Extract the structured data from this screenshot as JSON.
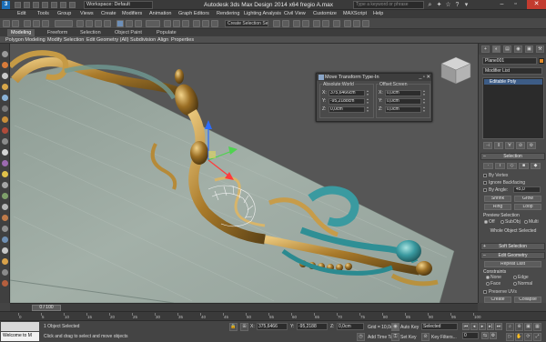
{
  "titlebar": {
    "app_icon_letter": "3",
    "workspace": "Workspace: Default",
    "title": "Autodesk 3ds Max Design 2014 x64     fregio A.max",
    "search_placeholder": "Type a keyword or phrase",
    "minimize": "–",
    "restore": "▫",
    "close": "✕"
  },
  "menu": [
    "Edit",
    "Tools",
    "Group",
    "Views",
    "Create",
    "Modifiers",
    "Animation",
    "Graph Editors",
    "Rendering",
    "Lighting Analysis",
    "Civil View",
    "Customize",
    "MAXScript",
    "Help"
  ],
  "toolbar": {
    "selection_set": "Create Selection Se"
  },
  "ribbon": {
    "tabs": [
      "Modeling",
      "Freeform",
      "Selection",
      "Object Paint",
      "Populate"
    ],
    "active_tab": 0,
    "sub": [
      "Polygon Modeling",
      "Modify Selection",
      "Edit",
      "Geometry (All)",
      "Subdivision",
      "Align",
      "Properties"
    ]
  },
  "viewport": {
    "label": "[+] [Perspective] [Shaded + Edged Faces]"
  },
  "move_dialog": {
    "title": "Move Transform Type-In",
    "buttons": "_ ▫ ✕",
    "absolute": {
      "legend": "Absolute:World",
      "rows": [
        {
          "axis": "X:",
          "value": "375,6466cm"
        },
        {
          "axis": "Y:",
          "value": "-95,2188cm"
        },
        {
          "axis": "Z:",
          "value": "0,0cm"
        }
      ]
    },
    "offset": {
      "legend": "Offset:Screen",
      "rows": [
        {
          "axis": "X:",
          "value": "0,0cm"
        },
        {
          "axis": "Y:",
          "value": "0,0cm"
        },
        {
          "axis": "Z:",
          "value": "0,0cm"
        }
      ]
    }
  },
  "command_panel": {
    "tabs": [
      "+",
      "◐",
      "▤",
      "◉",
      "▣",
      "⚒"
    ],
    "object_name": "Plane001",
    "modifier_list": "Modifier List",
    "stack_item": "Editable Poly",
    "stack_buttons": [
      "⊣",
      "⫴",
      "∀",
      "⊘",
      "⚙"
    ],
    "selection_rollout": "Selection",
    "sub_obj_icons": [
      "·",
      "⌇",
      "◇",
      "■",
      "◆"
    ],
    "by_vertex": "By Vertex",
    "ignore_backfacing": "Ignore Backfacing",
    "by_angle": "By Angle:",
    "by_angle_value": "45,0",
    "shrink": "Shrink",
    "grow": "Grow",
    "ring": "Ring",
    "loop": "Loop",
    "preview_selection": "Preview Selection",
    "preview_options": [
      "Off",
      "SubObj",
      "Multi"
    ],
    "status": "Whole Object Selected",
    "soft_selection": "Soft Selection",
    "edit_geometry": "Edit Geometry",
    "repeat_last": "Repeat Last",
    "constraints": "Constraints",
    "constraint_options": [
      "None",
      "Edge",
      "Face",
      "Normal"
    ],
    "preserve_uvs": "Preserve UVs",
    "create": "Create",
    "collapse": "Collapse",
    "attach": "Attach",
    "detach": "Detach"
  },
  "timeline": {
    "frame": "0 / 100",
    "ticks": [
      "0",
      "5",
      "10",
      "15",
      "20",
      "25",
      "30",
      "35",
      "40",
      "45",
      "50",
      "55",
      "60",
      "65",
      "70",
      "75",
      "80",
      "85",
      "90",
      "95",
      "100"
    ]
  },
  "status": {
    "maxscript_top": "",
    "maxscript": "Welcome to M",
    "selected": "1 Object Selected",
    "prompt": "Click and drag to select and move objects",
    "x_label": "X:",
    "x_value": "375,6466",
    "y_label": "Y:",
    "y_value": "-95,2188",
    "z_label": "Z:",
    "z_value": "0,0cm",
    "grid": "Grid = 10,0cm",
    "time_tag": "Add Time Tag",
    "auto_key": "Auto Key",
    "set_key": "Set Key",
    "selected_dropdown": "Selected",
    "key_filters": "Key Filters...",
    "frame_value": "0"
  }
}
